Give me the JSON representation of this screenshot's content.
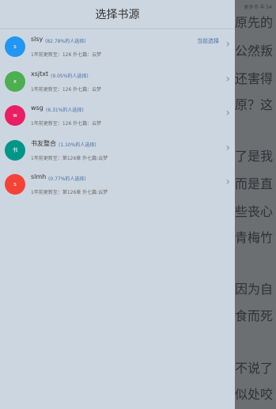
{
  "reader": {
    "status_text": "更多书 丰 54",
    "lines": [
      "原先的",
      "公然叛",
      "还害得",
      "原？这",
      "了是我",
      "而是直",
      "些丧心",
      "青梅竹",
      "因为自",
      "食而死",
      "不说了",
      "似处咬"
    ]
  },
  "drawer": {
    "title": "选择书源",
    "current_label": "当前选择"
  },
  "sources": [
    {
      "avatar_letter": "s",
      "avatar_color": "#2196f3",
      "name": "slsy",
      "percent": "(82.78%的人选择)",
      "update": "1年前更新至：126 外七篇：云梦",
      "current": true
    },
    {
      "avatar_letter": "x",
      "avatar_color": "#4caf50",
      "name": "xsjtxt",
      "percent": "(9.05%的人选择)",
      "update": "1年前更新至：126 外七篇：云梦",
      "current": false
    },
    {
      "avatar_letter": "w",
      "avatar_color": "#e91e63",
      "name": "wsg",
      "percent": "(6.31%的人选择)",
      "update": "1年前更新至：126 外七篇：云梦",
      "current": false
    },
    {
      "avatar_letter": "书",
      "avatar_color": "#009688",
      "name": "书友整合",
      "percent": "(1.10%的人选择)",
      "update": "1年前更新至：第126章 外七篇:云梦",
      "current": false
    },
    {
      "avatar_letter": "s",
      "avatar_color": "#f44336",
      "name": "slmh",
      "percent": "(0.77%的人选择)",
      "update": "1年前更新至：第126章 外七篇:云梦",
      "current": false
    }
  ]
}
